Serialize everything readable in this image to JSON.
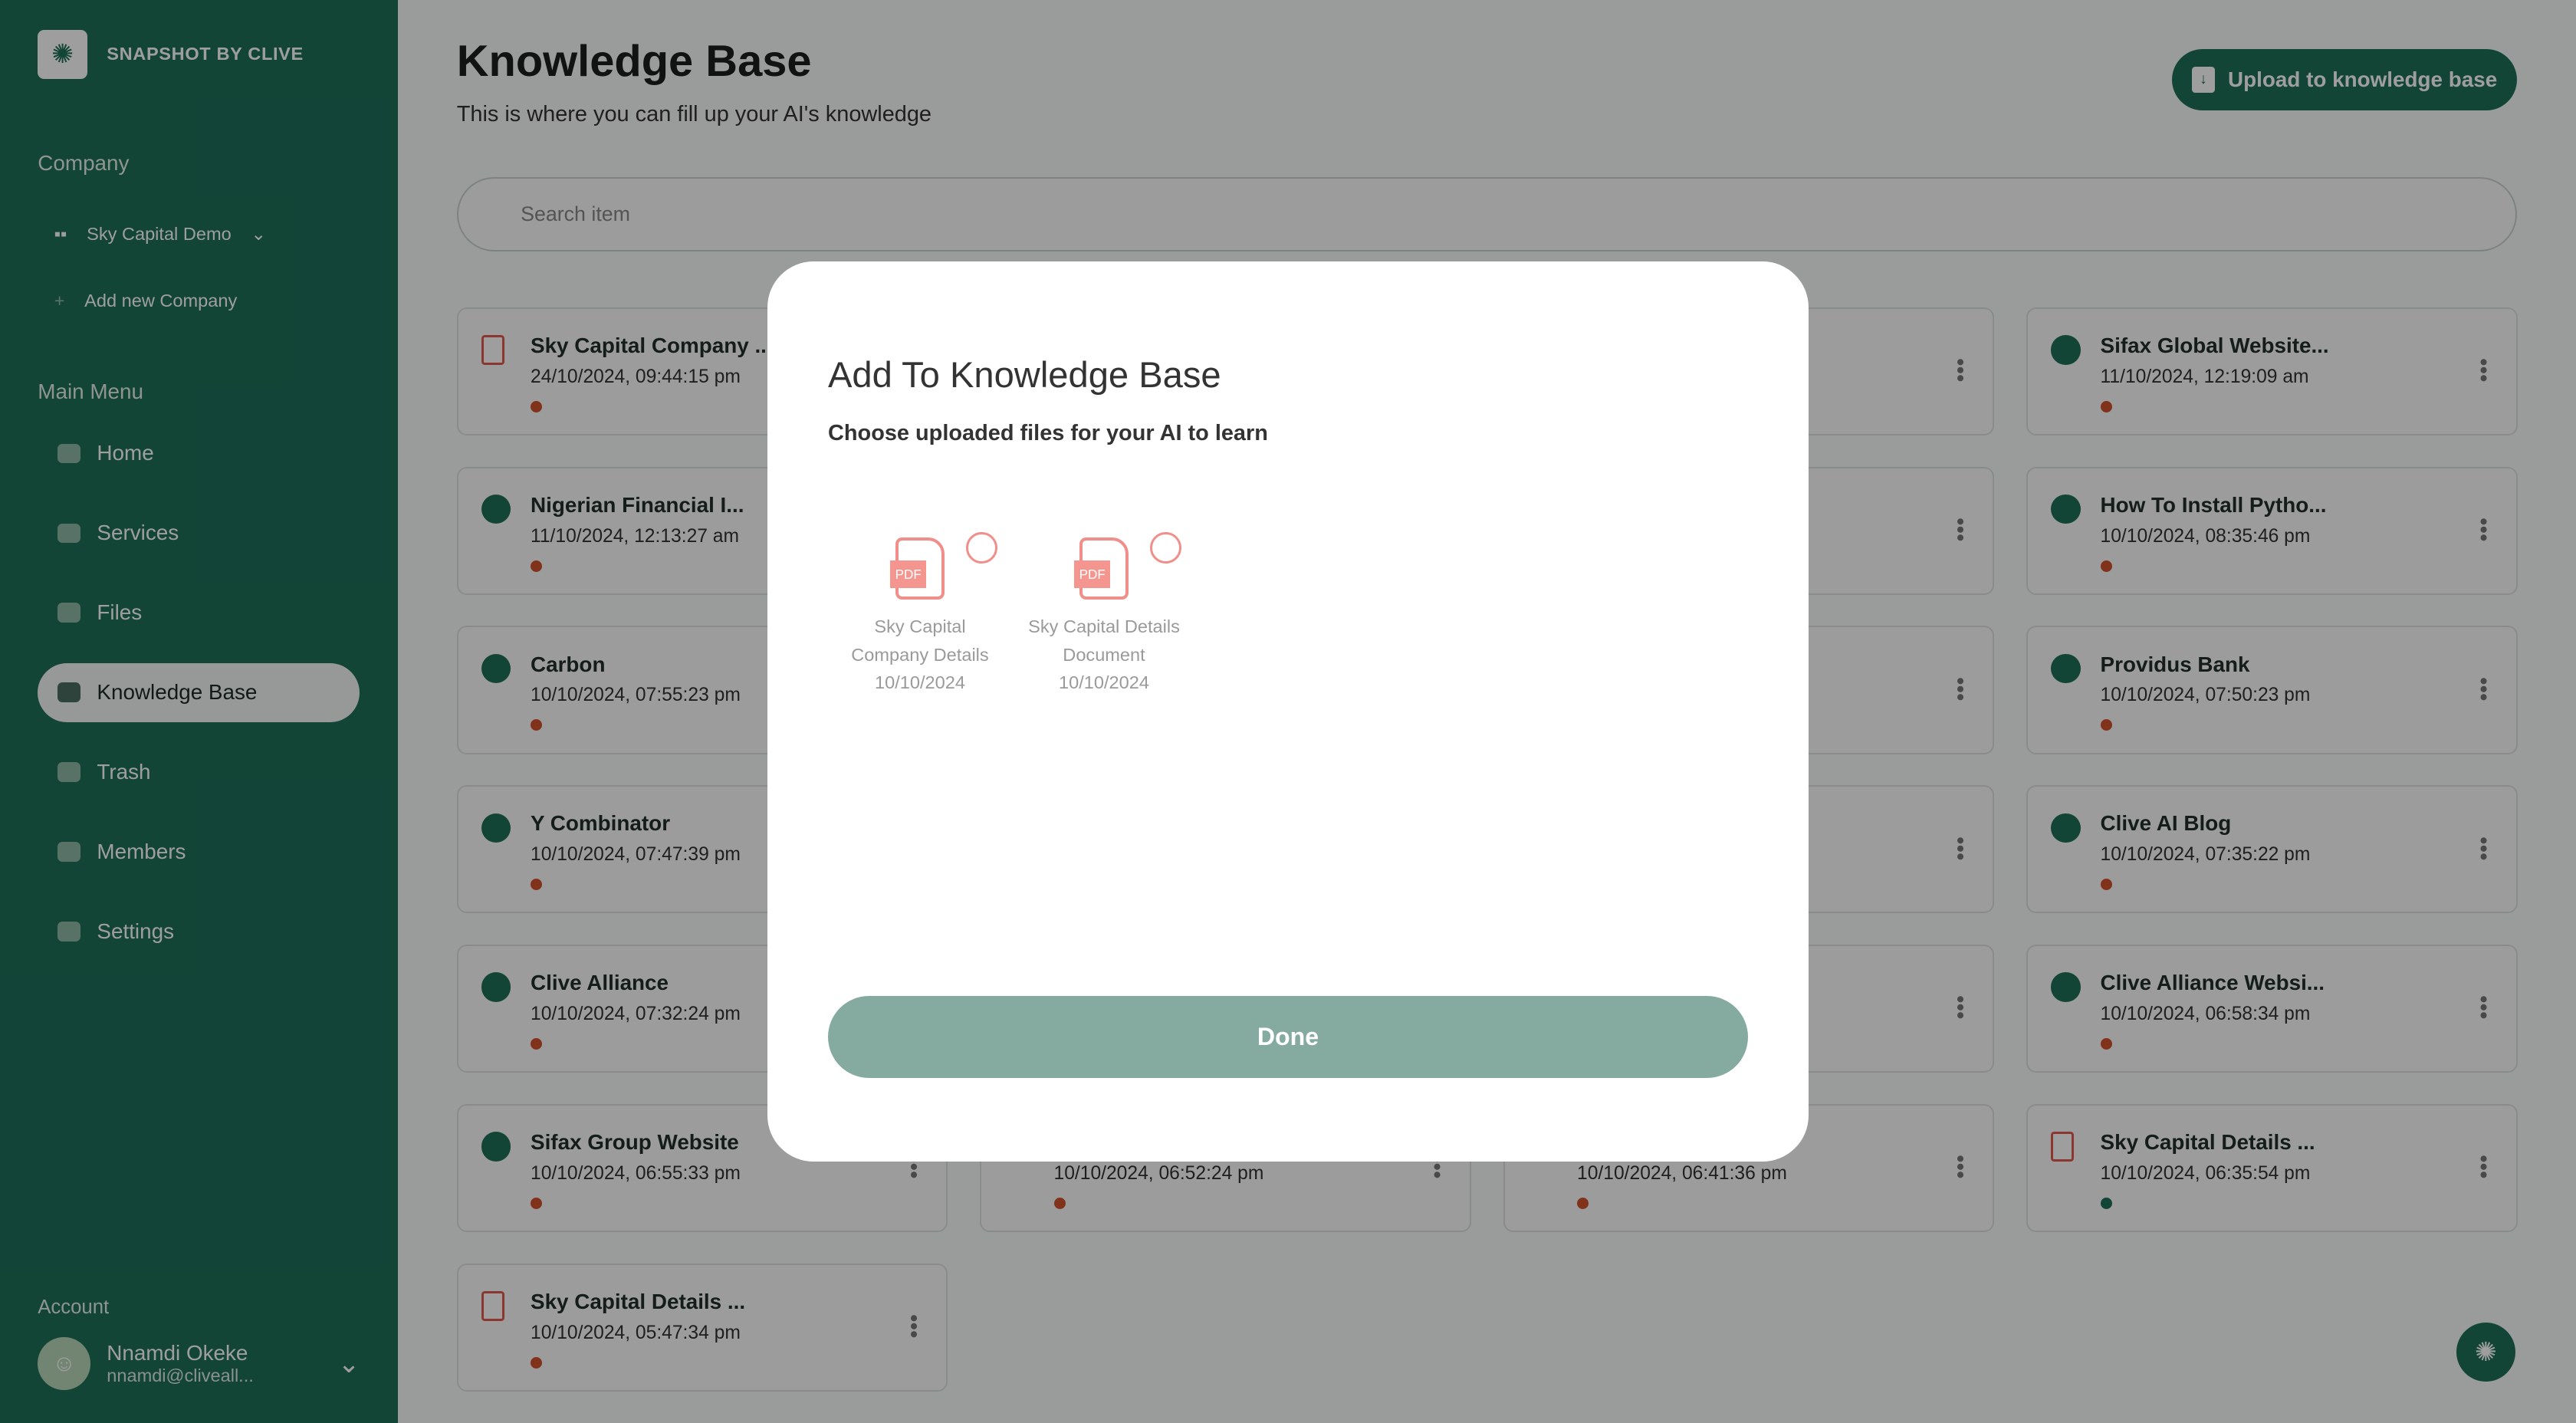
{
  "sidebar": {
    "brand": "SNAPSHOT BY CLIVE",
    "company_label": "Company",
    "company": "Sky Capital Demo",
    "add_company": "Add new Company",
    "menu_label": "Main Menu",
    "items": [
      {
        "label": "Home",
        "icon": "home-icon"
      },
      {
        "label": "Services",
        "icon": "services-icon"
      },
      {
        "label": "Files",
        "icon": "folder-icon"
      },
      {
        "label": "Knowledge Base",
        "icon": "book-icon",
        "active": true
      },
      {
        "label": "Trash",
        "icon": "trash-icon"
      },
      {
        "label": "Members",
        "icon": "users-icon"
      },
      {
        "label": "Settings",
        "icon": "gear-icon"
      }
    ],
    "account_label": "Account",
    "user_name": "Nnamdi Okeke",
    "user_email": "nnamdi@cliveall..."
  },
  "header": {
    "title": "Knowledge Base",
    "subtitle": "This is where you can fill up your AI's knowledge",
    "upload": "Upload to knowledge base"
  },
  "search": {
    "placeholder": "Search item"
  },
  "cards": [
    {
      "col": 0,
      "row": 0,
      "icon": "pdf",
      "title": "Sky Capital Company ...",
      "date": "24/10/2024, 09:44:15 pm",
      "status": "red"
    },
    {
      "col": 3,
      "row": 0,
      "icon": "globe",
      "title": "Sifax Global Website...",
      "date": "11/10/2024, 12:19:09 am",
      "status": "red"
    },
    {
      "col": 0,
      "row": 1,
      "icon": "globe",
      "title": "Nigerian Financial I...",
      "date": "11/10/2024, 12:13:27 am",
      "status": "red"
    },
    {
      "col": 3,
      "row": 1,
      "icon": "globe",
      "title": "How To Install Pytho...",
      "date": "10/10/2024, 08:35:46 pm",
      "status": "red"
    },
    {
      "col": 0,
      "row": 2,
      "icon": "globe",
      "title": "Carbon",
      "date": "10/10/2024, 07:55:23 pm",
      "status": "red"
    },
    {
      "col": 3,
      "row": 2,
      "icon": "globe",
      "title": "Providus Bank",
      "date": "10/10/2024, 07:50:23 pm",
      "status": "red"
    },
    {
      "col": 0,
      "row": 3,
      "icon": "globe",
      "title": "Y Combinator",
      "date": "10/10/2024, 07:47:39 pm",
      "status": "red"
    },
    {
      "col": 3,
      "row": 3,
      "icon": "globe",
      "title": "Clive AI Blog",
      "date": "10/10/2024, 07:35:22 pm",
      "status": "red"
    },
    {
      "col": 0,
      "row": 4,
      "icon": "globe",
      "title": "Clive Alliance",
      "date": "10/10/2024, 07:32:24 pm",
      "status": "red"
    },
    {
      "col": 3,
      "row": 4,
      "icon": "globe",
      "title": "Clive Alliance Websi...",
      "date": "10/10/2024, 06:58:34 pm",
      "status": "red"
    },
    {
      "col": 0,
      "row": 5,
      "icon": "globe",
      "title": "Sifax Group Website",
      "date": "10/10/2024, 06:55:33 pm",
      "status": "red"
    },
    {
      "col": 1,
      "row": 5,
      "icon": "globe",
      "title": "",
      "date": "10/10/2024, 06:52:24 pm",
      "status": "red"
    },
    {
      "col": 2,
      "row": 5,
      "icon": "pdf",
      "title": "",
      "date": "10/10/2024, 06:41:36 pm",
      "status": "red"
    },
    {
      "col": 3,
      "row": 5,
      "icon": "pdf",
      "title": "Sky Capital Details ...",
      "date": "10/10/2024, 06:35:54 pm",
      "status": "green"
    },
    {
      "col": 0,
      "row": 6,
      "icon": "pdf",
      "title": "Sky Capital Details ...",
      "date": "10/10/2024, 05:47:34 pm",
      "status": "red"
    },
    {
      "col": 1,
      "row": 0,
      "icon": "",
      "title": "",
      "date": "",
      "status": ""
    },
    {
      "col": 2,
      "row": 0,
      "icon": "",
      "title": "",
      "date": "",
      "status": ""
    },
    {
      "col": 1,
      "row": 1,
      "icon": "",
      "title": "",
      "date": "",
      "status": ""
    },
    {
      "col": 2,
      "row": 1,
      "icon": "",
      "title": "",
      "date": "",
      "status": ""
    },
    {
      "col": 1,
      "row": 2,
      "icon": "",
      "title": "",
      "date": "",
      "status": ""
    },
    {
      "col": 2,
      "row": 2,
      "icon": "",
      "title": "",
      "date": "",
      "status": ""
    },
    {
      "col": 1,
      "row": 3,
      "icon": "",
      "title": "",
      "date": "",
      "status": ""
    },
    {
      "col": 2,
      "row": 3,
      "icon": "",
      "title": "",
      "date": "",
      "status": ""
    },
    {
      "col": 1,
      "row": 4,
      "icon": "",
      "title": "",
      "date": "",
      "status": ""
    },
    {
      "col": 2,
      "row": 4,
      "icon": "",
      "title": "",
      "date": "",
      "status": ""
    }
  ],
  "modal": {
    "title": "Add To Knowledge Base",
    "subtitle": "Choose uploaded files for your AI to learn",
    "pdf_badge": "PDF",
    "files": [
      {
        "name": "Sky Capital Company Details",
        "date": "10/10/2024",
        "selected": false
      },
      {
        "name": "Sky Capital Details Document",
        "date": "10/10/2024",
        "selected": false
      }
    ],
    "done": "Done"
  },
  "colors": {
    "brand": "#1d7058",
    "status_red": "#d0522d",
    "status_green": "#1d7058",
    "pdf": "#f08f8a"
  }
}
